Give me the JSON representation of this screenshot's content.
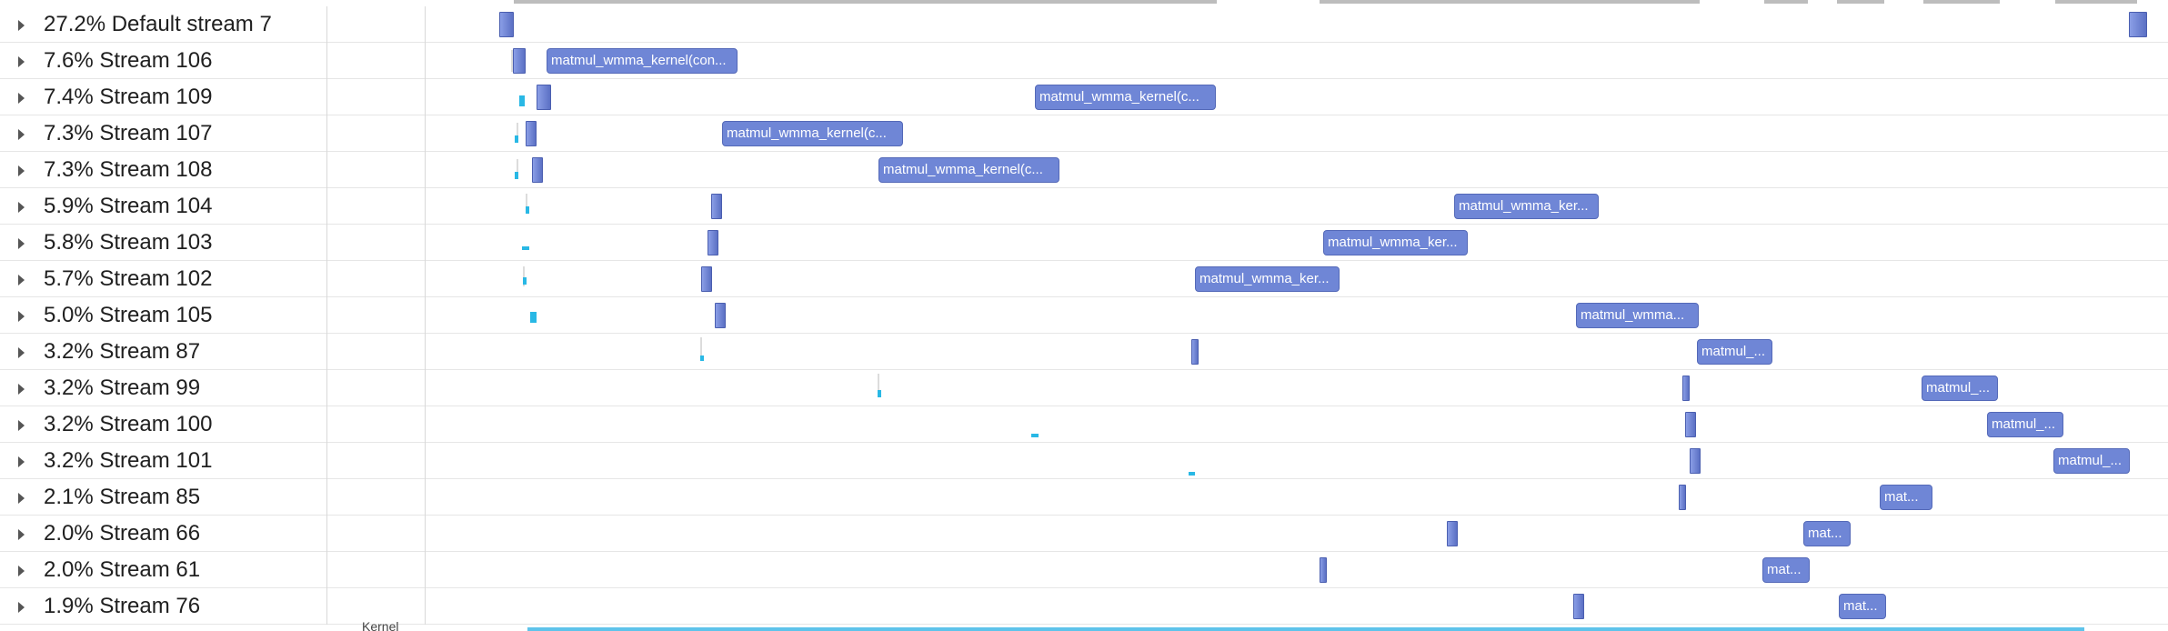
{
  "colors": {
    "kernel": "#6f86d6",
    "memcpy": "#29b8e5",
    "accent_line": "#5ec3ea"
  },
  "rows": [
    {
      "label": "27.2% Default stream 7",
      "kernels": []
    },
    {
      "label": "7.6% Stream 106",
      "kernels": [
        "matmul_wmma_kernel(con..."
      ]
    },
    {
      "label": "7.4% Stream 109",
      "kernels": [
        "matmul_wmma_kernel(c..."
      ]
    },
    {
      "label": "7.3% Stream 107",
      "kernels": [
        "matmul_wmma_kernel(c..."
      ]
    },
    {
      "label": "7.3% Stream 108",
      "kernels": [
        "matmul_wmma_kernel(c..."
      ]
    },
    {
      "label": "5.9% Stream 104",
      "kernels": [
        "matmul_wmma_ker..."
      ]
    },
    {
      "label": "5.8% Stream 103",
      "kernels": [
        "matmul_wmma_ker..."
      ]
    },
    {
      "label": "5.7% Stream 102",
      "kernels": [
        "matmul_wmma_ker..."
      ]
    },
    {
      "label": "5.0% Stream 105",
      "kernels": [
        "matmul_wmma..."
      ]
    },
    {
      "label": "3.2% Stream 87",
      "kernels": [
        "matmul_..."
      ]
    },
    {
      "label": "3.2% Stream 99",
      "kernels": [
        "matmul_..."
      ]
    },
    {
      "label": "3.2% Stream 100",
      "kernels": [
        "matmul_..."
      ]
    },
    {
      "label": "3.2% Stream 101",
      "kernels": [
        "matmul_..."
      ]
    },
    {
      "label": "2.1% Stream 85",
      "kernels": [
        "mat..."
      ]
    },
    {
      "label": "2.0% Stream 66",
      "kernels": [
        "mat..."
      ]
    },
    {
      "label": "2.0% Stream 61",
      "kernels": [
        "mat..."
      ]
    },
    {
      "label": "1.9% Stream 76",
      "kernels": [
        "mat..."
      ]
    }
  ],
  "bottom": {
    "label": "Kernel"
  }
}
